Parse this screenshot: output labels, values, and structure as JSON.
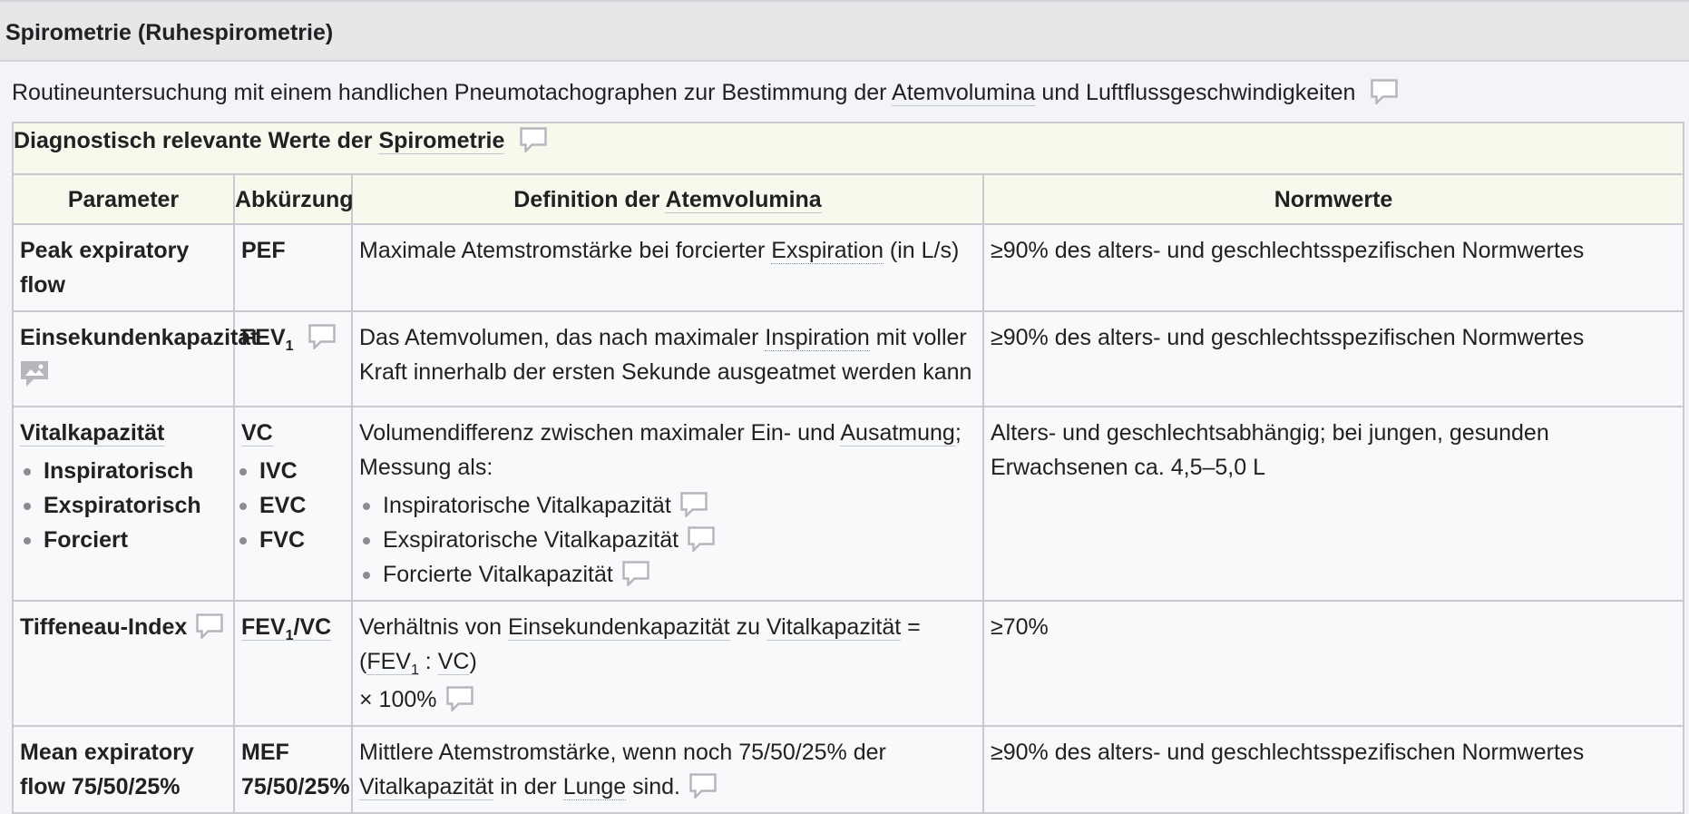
{
  "section": {
    "title": "Spirometrie (Ruhespirometrie)"
  },
  "intro": {
    "before": "Routineuntersuchung mit einem handlichen Pneumotachographen zur Bestimmung der ",
    "link": "Atemvolumina",
    "after": " und Luftflussgeschwindigkeiten"
  },
  "table": {
    "caption_before": "Diagnostisch relevante Werte der ",
    "caption_link": "Spirometrie",
    "headers": {
      "parameter": "Parameter",
      "abbrev": "Abkürzung",
      "definition_before": "Definition der ",
      "definition_link": "Atemvolumina",
      "norm": "Normwerte"
    },
    "rows": {
      "pef": {
        "parameter": "Peak expiratory flow",
        "abbrev": "PEF",
        "def_before": "Maximale Atemstromstärke bei forcierter ",
        "def_link": "Exspiration",
        "def_after": " (in L/s)",
        "norm": "≥90% des alters- und geschlechtsspezifischen Normwertes"
      },
      "fev1": {
        "parameter": "Einsekundenkapazität",
        "abbrev_main": "FEV",
        "abbrev_sub": "1",
        "def_before": "Das Atemvolumen, das nach maximaler ",
        "def_link": "Inspiration",
        "def_after": " mit voller Kraft innerhalb der ersten Sekunde ausgeatmet werden kann",
        "norm": "≥90% des alters- und geschlechtsspezifischen Normwertes"
      },
      "vc": {
        "parameter": "Vitalkapazität",
        "parameter_items": [
          "Inspiratorisch",
          "Exspiratorisch",
          "Forciert"
        ],
        "abbrev": "VC",
        "abbrev_items": [
          "IVC",
          "EVC",
          "FVC"
        ],
        "def_before": "Volumendifferenz zwischen maximaler Ein- und ",
        "def_link": "Ausatmung",
        "def_after": "; Messung als:",
        "def_items": [
          "Inspiratorische Vitalkapazität",
          "Exspiratorische Vitalkapazität",
          "Forcierte Vitalkapazität"
        ],
        "norm": "Alters- und geschlechtsabhängig; bei jungen, gesunden Erwachsenen ca. 4,5–5,0 L"
      },
      "tiffeneau": {
        "parameter": "Tiffeneau-Index",
        "abbrev_main": "FEV",
        "abbrev_sub": "1",
        "abbrev_tail": "/VC",
        "def_before": "Verhältnis von ",
        "def_link1": "Einsekundenkapazität",
        "def_mid1": " zu ",
        "def_link2": "Vitalkapazität",
        "def_mid2": " = (",
        "def_link3_main": "FEV",
        "def_link3_sub": "1",
        "def_mid3": " : ",
        "def_link4": "VC",
        "def_mid4": ")",
        "def_after": "× 100%",
        "norm": "≥70%"
      },
      "mef": {
        "parameter": "Mean expiratory flow 75/50/25%",
        "abbrev": "MEF 75/50/25%",
        "def_before": "Mittlere Atemstromstärke, wenn noch 75/50/25% der ",
        "def_link1": "Vitalkapazität",
        "def_mid": " in der ",
        "def_link2": "Lunge",
        "def_after": " sind.",
        "norm": "≥90% des alters- und geschlechtsspezifischen Normwertes"
      }
    }
  },
  "icons": {
    "comment": "speech-bubble-icon",
    "image_comment": "image-comment-icon"
  }
}
